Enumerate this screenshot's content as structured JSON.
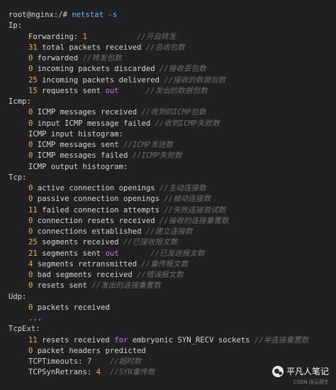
{
  "prompt": "root@nginx:/# ",
  "command": "netstat -s",
  "lines": {
    "ip": "Ip:",
    "ip1": {
      "num": "1",
      "text_before": "Forwarding: ",
      "comment": "//开启转发"
    },
    "ip2": {
      "num": "31",
      "text": " total packets received",
      "comment": "//总收包数"
    },
    "ip3": {
      "num": "0",
      "text": " forwarded",
      "comment": "//转发包数"
    },
    "ip4": {
      "num": "0",
      "text": " incoming packets discarded",
      "comment": "//接收丢包数"
    },
    "ip5": {
      "num": "25",
      "text": " incoming packets delivered",
      "comment": "//接收的数据包数"
    },
    "ip6": {
      "num": "15",
      "text": " requests sent ",
      "kw": "out",
      "comment": "//发出的数据包数"
    },
    "icmp": "Icmp:",
    "icmp1": {
      "num": "0",
      "text": " ICMP messages received",
      "comment": "//收到的ICMP包数"
    },
    "icmp2": {
      "num": "0",
      "text": " input ICMP message failed",
      "comment": "//收到ICMP失败数"
    },
    "icmp3": {
      "text": "ICMP input histogram:"
    },
    "icmp4": {
      "num": "0",
      "text": " ICMP messages sent",
      "comment": "//ICMP发送数"
    },
    "icmp5": {
      "num": "0",
      "text": " ICMP messages failed",
      "comment": "//ICMP失败数"
    },
    "icmp6": {
      "text": "ICMP output histogram:"
    },
    "tcp": "Tcp:",
    "tcp1": {
      "num": "0",
      "text": " active connection openings",
      "comment": "//主动连接数"
    },
    "tcp2": {
      "num": "0",
      "text": " passive connection openings",
      "comment": "//被动连接数"
    },
    "tcp3": {
      "num": "11",
      "text": " failed connection attempts",
      "comment": "//失败连接尝试数"
    },
    "tcp4": {
      "num": "0",
      "text": " connection resets received",
      "comment": "//接收的连接重置数"
    },
    "tcp5": {
      "num": "0",
      "text": " connections established",
      "comment": "//建立连接数"
    },
    "tcp6": {
      "num": "25",
      "text": " segments received",
      "comment": "//已接收报文数"
    },
    "tcp7": {
      "num": "21",
      "text": " segments sent ",
      "kw": "out",
      "comment": "//已发送报文数"
    },
    "tcp8": {
      "num": "4",
      "text": " segments retransmitted",
      "comment": "//重传报文数"
    },
    "tcp9": {
      "num": "0",
      "text": " bad segments received",
      "comment": "//错误报文数"
    },
    "tcp10": {
      "num": "0",
      "text": " resets sent",
      "comment": "//发出的连接重置数"
    },
    "udp": "Udp:",
    "udp1": {
      "num": "0",
      "text": " packets received"
    },
    "udp2": {
      "text": "..."
    },
    "tcpext": "TcpExt:",
    "tcpext1": {
      "num": "11",
      "text": " resets received ",
      "kw": "for",
      "text_after": " embryonic SYN_RECV sockets",
      "comment": "//半连接重置数"
    },
    "tcpext2": {
      "num": "0",
      "text": " packet headers predicted"
    },
    "tcpext3": {
      "text_before": "TCPTimeouts: ",
      "num": "7",
      "comment": "//超时数"
    },
    "tcpext4": {
      "text_before": "TCPSynRetrans: ",
      "num": "4",
      "comment": "//SYN重传数"
    }
  },
  "watermark": {
    "label": "平凡人笔记",
    "icon": "wechat-icon",
    "sub": "CSDN @云原生"
  },
  "colors": {
    "background": "#202022",
    "number": "#e7b44c",
    "keyword": "#c27cd6",
    "comment": "#6f6f6f",
    "command": "#6fb4f0"
  }
}
